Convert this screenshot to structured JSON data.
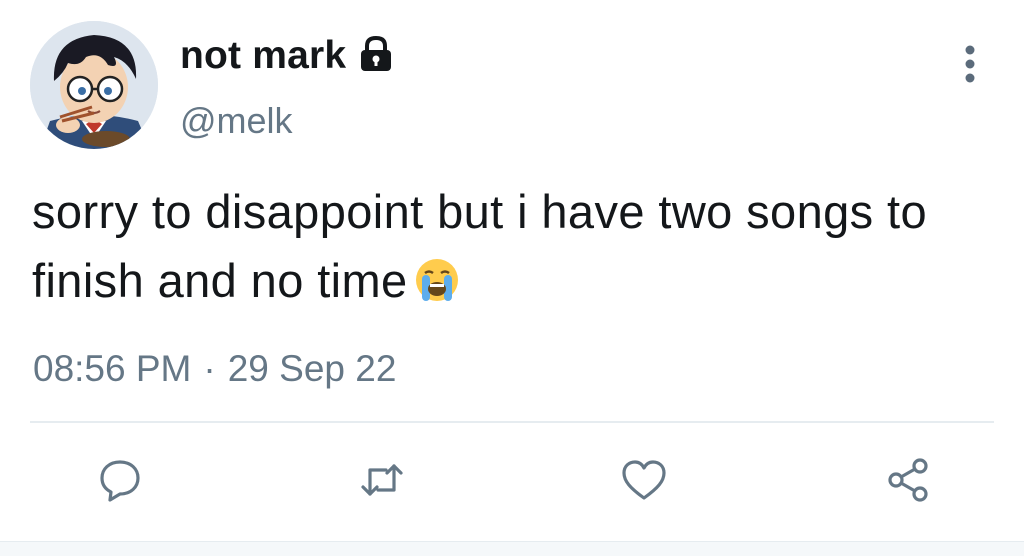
{
  "author": {
    "display_name": "not mark",
    "handle": "@melk",
    "protected": true,
    "avatar": "cartoon-boy-with-glasses"
  },
  "tweet": {
    "text": "sorry to disappoint but i have two songs to finish and no time",
    "emoji": "loudly-crying-face",
    "time": "08:56 PM",
    "separator": "·",
    "date": "29 Sep 22"
  },
  "actions": {
    "reply_icon": "reply-icon",
    "retweet_icon": "retweet-icon",
    "like_icon": "heart-icon",
    "share_icon": "share-icon"
  },
  "colors": {
    "text_primary": "#14171a",
    "text_secondary": "#657786",
    "divider": "#e6ecf0"
  }
}
